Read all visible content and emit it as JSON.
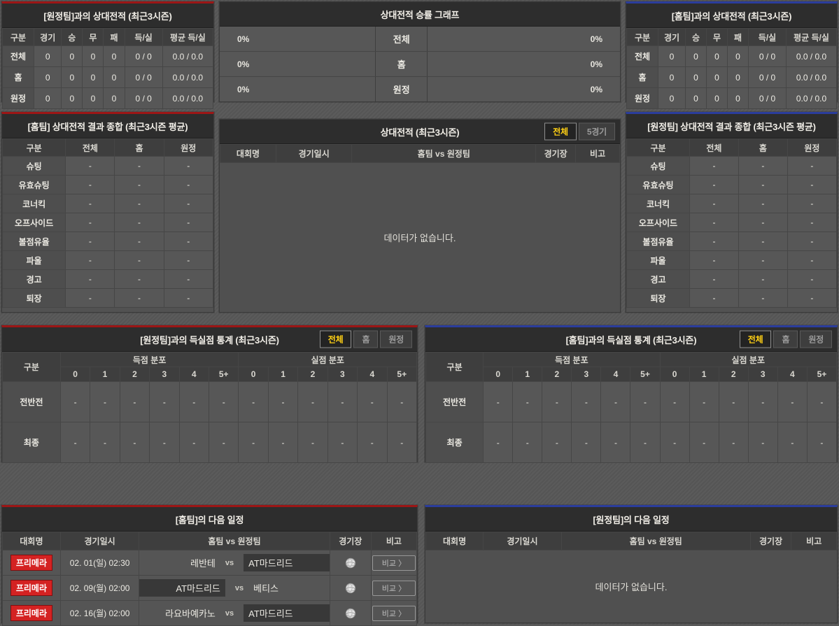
{
  "colors": {
    "red_accent": "#9c1616",
    "blue_accent": "#2b3d9c",
    "tab_active_text": "#ffd014",
    "badge_red": "#d42222"
  },
  "h2h_away": {
    "title": "[원정팀]과의 상대전적 (최근3시즌)",
    "columns": [
      "구분",
      "경기",
      "승",
      "무",
      "패",
      "득/실",
      "평균 득/실"
    ],
    "rows": [
      {
        "label": "전체",
        "values": [
          "0",
          "0",
          "0",
          "0",
          "0 / 0",
          "0.0 / 0.0"
        ]
      },
      {
        "label": "홈",
        "values": [
          "0",
          "0",
          "0",
          "0",
          "0 / 0",
          "0.0 / 0.0"
        ]
      },
      {
        "label": "원정",
        "values": [
          "0",
          "0",
          "0",
          "0",
          "0 / 0",
          "0.0 / 0.0"
        ]
      }
    ]
  },
  "graph": {
    "title": "상대전적 승률 그래프",
    "rows": [
      {
        "label": "전체",
        "home_pct": "0%",
        "away_pct": "0%"
      },
      {
        "label": "홈",
        "home_pct": "0%",
        "away_pct": "0%"
      },
      {
        "label": "원정",
        "home_pct": "0%",
        "away_pct": "0%"
      }
    ]
  },
  "h2h_home": {
    "title": "[홈팀]과의 상대전적 (최근3시즌)",
    "columns": [
      "구분",
      "경기",
      "승",
      "무",
      "패",
      "득/실",
      "평균 득/실"
    ],
    "rows": [
      {
        "label": "전체",
        "values": [
          "0",
          "0",
          "0",
          "0",
          "0 / 0",
          "0.0 / 0.0"
        ]
      },
      {
        "label": "홈",
        "values": [
          "0",
          "0",
          "0",
          "0",
          "0 / 0",
          "0.0 / 0.0"
        ]
      },
      {
        "label": "원정",
        "values": [
          "0",
          "0",
          "0",
          "0",
          "0 / 0",
          "0.0 / 0.0"
        ]
      }
    ]
  },
  "summary_home": {
    "title": "[홈팀] 상대전적 결과 종합 (최근3시즌 평균)",
    "columns": [
      "구분",
      "전체",
      "홈",
      "원정"
    ],
    "rows": [
      {
        "label": "슈팅",
        "values": [
          "-",
          "-",
          "-"
        ]
      },
      {
        "label": "유효슈팅",
        "values": [
          "-",
          "-",
          "-"
        ]
      },
      {
        "label": "코너킥",
        "values": [
          "-",
          "-",
          "-"
        ]
      },
      {
        "label": "오프사이드",
        "values": [
          "-",
          "-",
          "-"
        ]
      },
      {
        "label": "볼점유율",
        "values": [
          "-",
          "-",
          "-"
        ]
      },
      {
        "label": "파울",
        "values": [
          "-",
          "-",
          "-"
        ]
      },
      {
        "label": "경고",
        "values": [
          "-",
          "-",
          "-"
        ]
      },
      {
        "label": "퇴장",
        "values": [
          "-",
          "-",
          "-"
        ]
      }
    ]
  },
  "summary_away": {
    "title": "[원정팀] 상대전적 결과 종합 (최근3시즌 평균)",
    "columns": [
      "구분",
      "전체",
      "홈",
      "원정"
    ],
    "rows": [
      {
        "label": "슈팅",
        "values": [
          "-",
          "-",
          "-"
        ]
      },
      {
        "label": "유효슈팅",
        "values": [
          "-",
          "-",
          "-"
        ]
      },
      {
        "label": "코너킥",
        "values": [
          "-",
          "-",
          "-"
        ]
      },
      {
        "label": "오프사이드",
        "values": [
          "-",
          "-",
          "-"
        ]
      },
      {
        "label": "볼점유율",
        "values": [
          "-",
          "-",
          "-"
        ]
      },
      {
        "label": "파울",
        "values": [
          "-",
          "-",
          "-"
        ]
      },
      {
        "label": "경고",
        "values": [
          "-",
          "-",
          "-"
        ]
      },
      {
        "label": "퇴장",
        "values": [
          "-",
          "-",
          "-"
        ]
      }
    ]
  },
  "h2h_list": {
    "title": "상대전적 (최근3시즌)",
    "tabs": {
      "items": [
        "전체",
        "5경기"
      ],
      "active": 0
    },
    "columns": [
      "대회명",
      "경기일시",
      "홈팀  vs  원정팀",
      "경기장",
      "비고"
    ],
    "empty": "데이터가 없습니다."
  },
  "goals_away": {
    "title": "[원정팀]과의 득실점 통계 (최근3시즌)",
    "tabs": {
      "items": [
        "전체",
        "홈",
        "원정"
      ],
      "active": 0
    },
    "corner_label": "구분",
    "group_score": "득점 분포",
    "group_concede": "실점 분포",
    "bins": [
      "0",
      "1",
      "2",
      "3",
      "4",
      "5+"
    ],
    "rows": [
      {
        "label": "전반전",
        "values": [
          "-",
          "-",
          "-",
          "-",
          "-",
          "-",
          "-",
          "-",
          "-",
          "-",
          "-",
          "-"
        ]
      },
      {
        "label": "최종",
        "values": [
          "-",
          "-",
          "-",
          "-",
          "-",
          "-",
          "-",
          "-",
          "-",
          "-",
          "-",
          "-"
        ]
      }
    ]
  },
  "goals_home": {
    "title": "[홈팀]과의 득실점 통계 (최근3시즌)",
    "tabs": {
      "items": [
        "전체",
        "홈",
        "원정"
      ],
      "active": 0
    },
    "corner_label": "구분",
    "group_score": "득점 분포",
    "group_concede": "실점 분포",
    "bins": [
      "0",
      "1",
      "2",
      "3",
      "4",
      "5+"
    ],
    "rows": [
      {
        "label": "전반전",
        "values": [
          "-",
          "-",
          "-",
          "-",
          "-",
          "-",
          "-",
          "-",
          "-",
          "-",
          "-",
          "-"
        ]
      },
      {
        "label": "최종",
        "values": [
          "-",
          "-",
          "-",
          "-",
          "-",
          "-",
          "-",
          "-",
          "-",
          "-",
          "-",
          "-"
        ]
      }
    ]
  },
  "schedule_home": {
    "title": "[홈팀]의 다음 일정",
    "columns": [
      "대회명",
      "경기일시",
      "홈팀  vs  원정팀",
      "경기장",
      "비고"
    ],
    "vs": "vs",
    "rows": [
      {
        "league": "프리메라",
        "datetime": "02. 01(일) 02:30",
        "home": "레반테",
        "away": "AT마드리드",
        "highlight": "away",
        "stadium_icon": "globe-icon",
        "compare": "비교 〉"
      },
      {
        "league": "프리메라",
        "datetime": "02. 09(월) 02:00",
        "home": "AT마드리드",
        "away": "베티스",
        "highlight": "home",
        "stadium_icon": "globe-icon",
        "compare": "비교 〉"
      },
      {
        "league": "프리메라",
        "datetime": "02. 16(월) 02:00",
        "home": "라요바예카노",
        "away": "AT마드리드",
        "highlight": "away",
        "stadium_icon": "globe-icon",
        "compare": "비교 〉"
      }
    ]
  },
  "schedule_away": {
    "title": "[원정팀]의 다음 일정",
    "columns": [
      "대회명",
      "경기일시",
      "홈팀  vs  원정팀",
      "경기장",
      "비고"
    ],
    "empty": "데이터가 없습니다."
  }
}
